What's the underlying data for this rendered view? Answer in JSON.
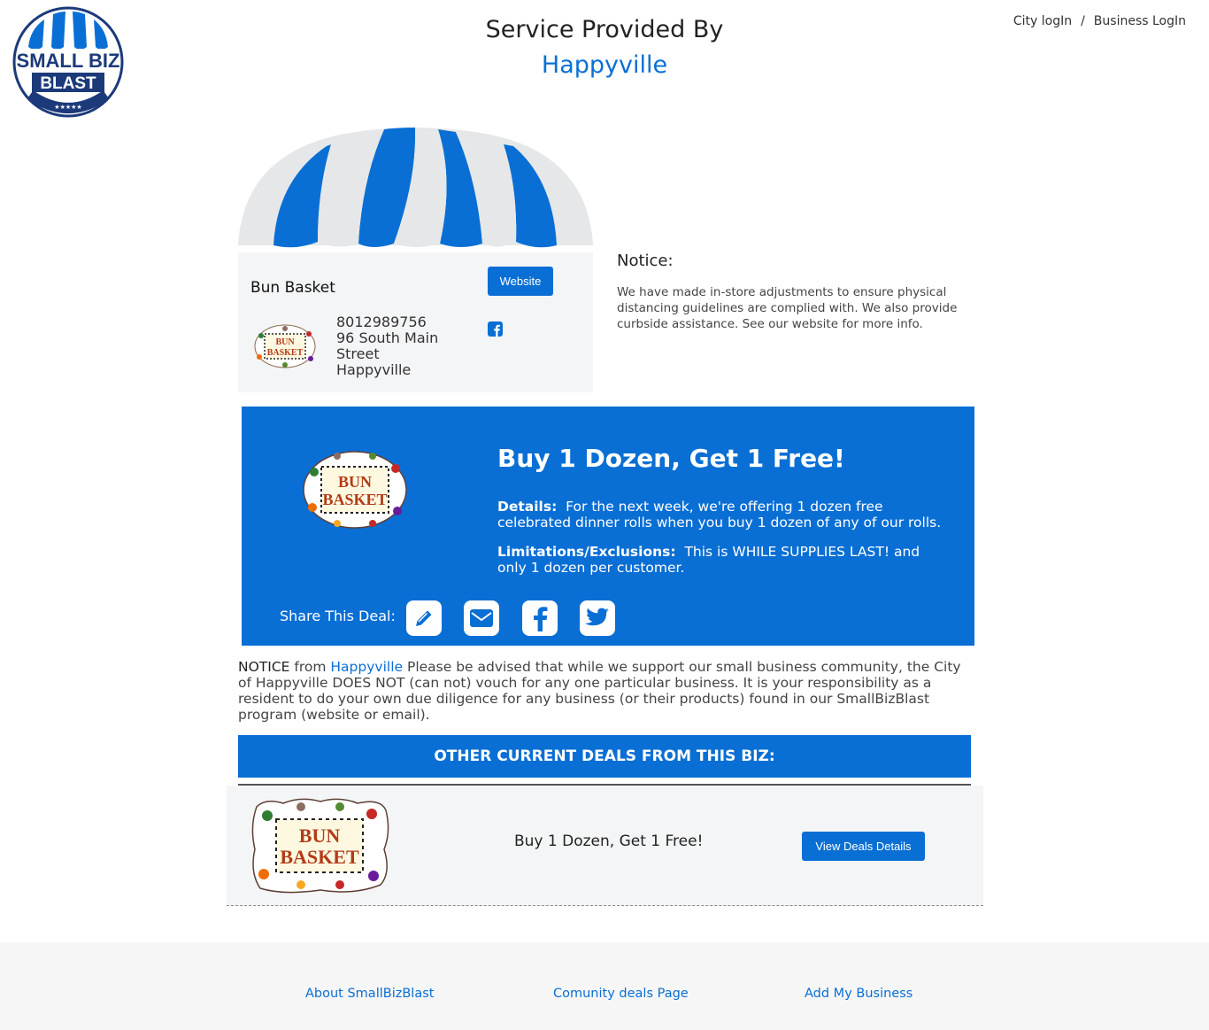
{
  "logo": {
    "line1": "SMALL BIZ",
    "line2": "BLAST",
    "stars": "★★★★★"
  },
  "header": {
    "title": "Service Provided By",
    "city": "Happyville"
  },
  "auth": {
    "city_login": "City logIn",
    "separator": "/",
    "business_login": "Business LogIn"
  },
  "business": {
    "name": "Bun Basket",
    "website_label": "Website",
    "phone": "8012989756",
    "address_line1": "96 South Main",
    "address_line2": "Street",
    "city": "Happyville",
    "logo_words": [
      "BUN",
      "BASKET"
    ]
  },
  "notice": {
    "heading": "Notice:",
    "text": "We have made in-store adjustments to ensure physical distancing guidelines are complied with. We also provide curbside assistance. See our website for more info."
  },
  "deal": {
    "title": "Buy 1 Dozen, Get 1 Free!",
    "details_label": "Details:",
    "details_text": "For the next week, we're offering 1 dozen free celebrated dinner rolls when you buy 1 dozen of any of our rolls.",
    "limits_label": "Limitations/Exclusions:",
    "limits_text": "This is WHILE SUPPLIES LAST! and only 1 dozen per customer.",
    "share_label": "Share This Deal:",
    "share_icons": [
      "pencil-icon",
      "email-icon",
      "facebook-icon",
      "twitter-icon"
    ]
  },
  "disclaimer": {
    "notice_word": "NOTICE",
    "from_word": "from",
    "city": "Happyville",
    "text": "Please be advised that while we support our small business community, the City of Happyville DOES NOT (can not) vouch for any one particular business. It is your responsibility as a resident to do your own due diligence for any business (or their products) found in our SmallBizBlast program (website or email)."
  },
  "other_deals": {
    "heading": "OTHER CURRENT DEALS FROM THIS BIZ:",
    "items": [
      {
        "title": "Buy 1 Dozen, Get 1 Free!",
        "button_label": "View Deals Details"
      }
    ]
  },
  "footer": {
    "about": "About SmallBizBlast",
    "community": "Comunity deals Page",
    "add_business": "Add My Business"
  },
  "colors": {
    "brand_blue": "#0a6fd4",
    "navy": "#1c3a7a",
    "awning_gray": "#e6e7e8",
    "panel_gray": "#f4f5f6"
  }
}
